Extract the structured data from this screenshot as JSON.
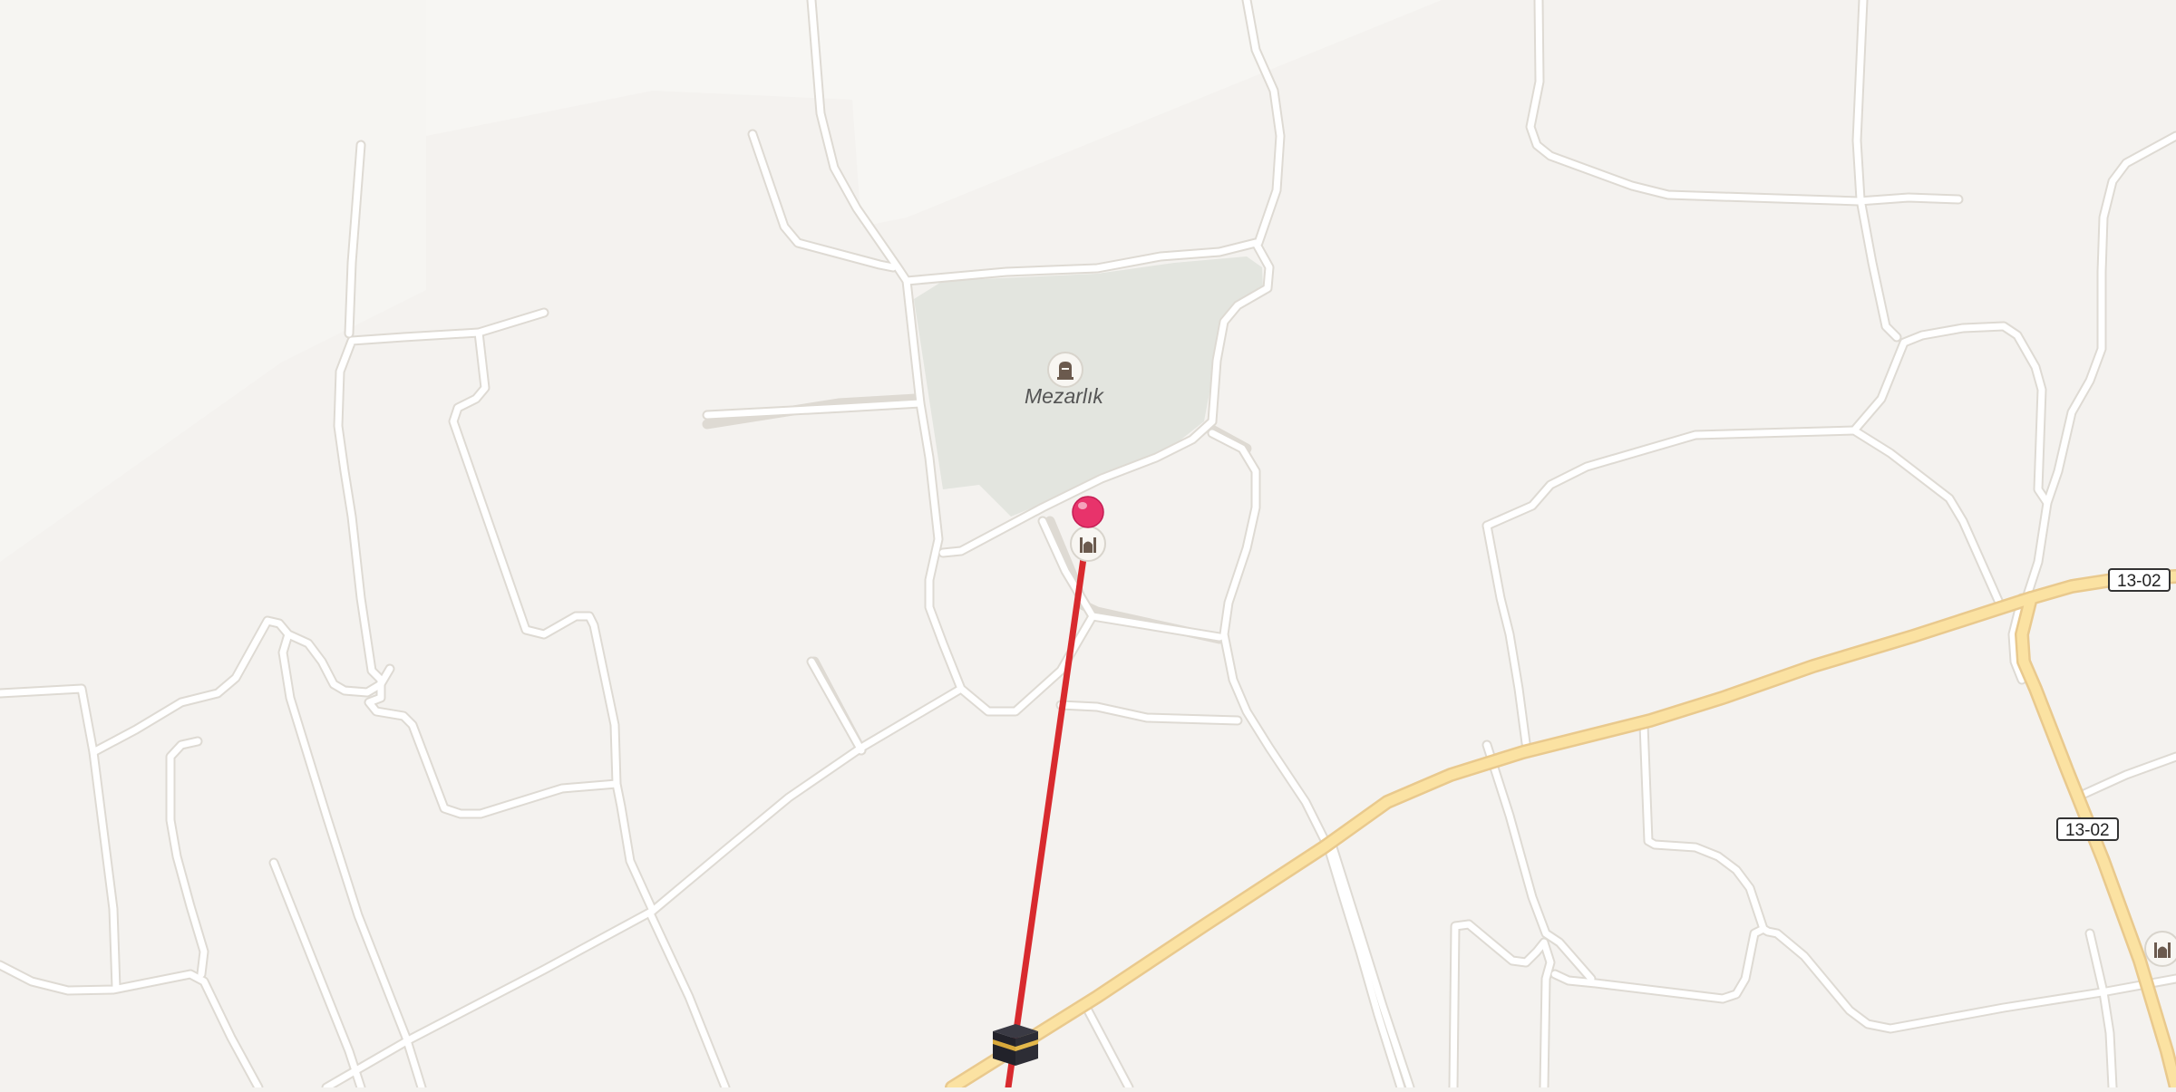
{
  "map": {
    "colors": {
      "land": "#f4f2ef",
      "cemetery": "#e3e5df",
      "road": "#ffffff",
      "highway": "#fbe2a2",
      "qibla_line": "#d82a2e",
      "pin": "#e8336b"
    },
    "labels": {
      "cemetery": "Mezarlık"
    },
    "route_shields": [
      "13-02",
      "13-02"
    ],
    "icons": {
      "cemetery": "grave-icon",
      "mosque": "mosque-icon",
      "kaaba": "kaaba-icon",
      "pin": "location-pin-icon"
    }
  }
}
